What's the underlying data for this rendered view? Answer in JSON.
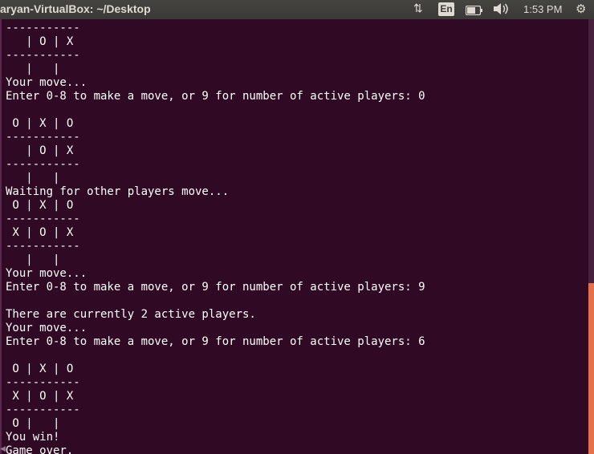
{
  "topbar": {
    "window_title": "aryan-VirtualBox: ~/Desktop",
    "network_icon": "⇅",
    "keyboard_layout": "En",
    "battery_icon": "▭",
    "volume_icon": "🔈",
    "clock": "1:53 PM",
    "settings_icon": "⚙"
  },
  "terminal": {
    "text": "-----------\n   | O | X\n-----------\n   |   |\nYour move...\nEnter 0-8 to make a move, or 9 for number of active players: 0\n\n O | X | O\n-----------\n   | O | X\n-----------\n   |   |\nWaiting for other players move...\n O | X | O\n-----------\n X | O | X\n-----------\n   |   |\nYour move...\nEnter 0-8 to make a move, or 9 for number of active players: 9\n\nThere are currently 2 active players.\nYour move...\nEnter 0-8 to make a move, or 9 for number of active players: 6\n\n O | X | O\n-----------\n X | O | X\n-----------\n O |   |\nYou win!\nGame over."
  },
  "colors": {
    "terminal_bg": "#300a24",
    "terminal_fg": "#ffffff",
    "panel_bg": "#3c3b37",
    "scrollbar_thumb": "#e4714a"
  }
}
